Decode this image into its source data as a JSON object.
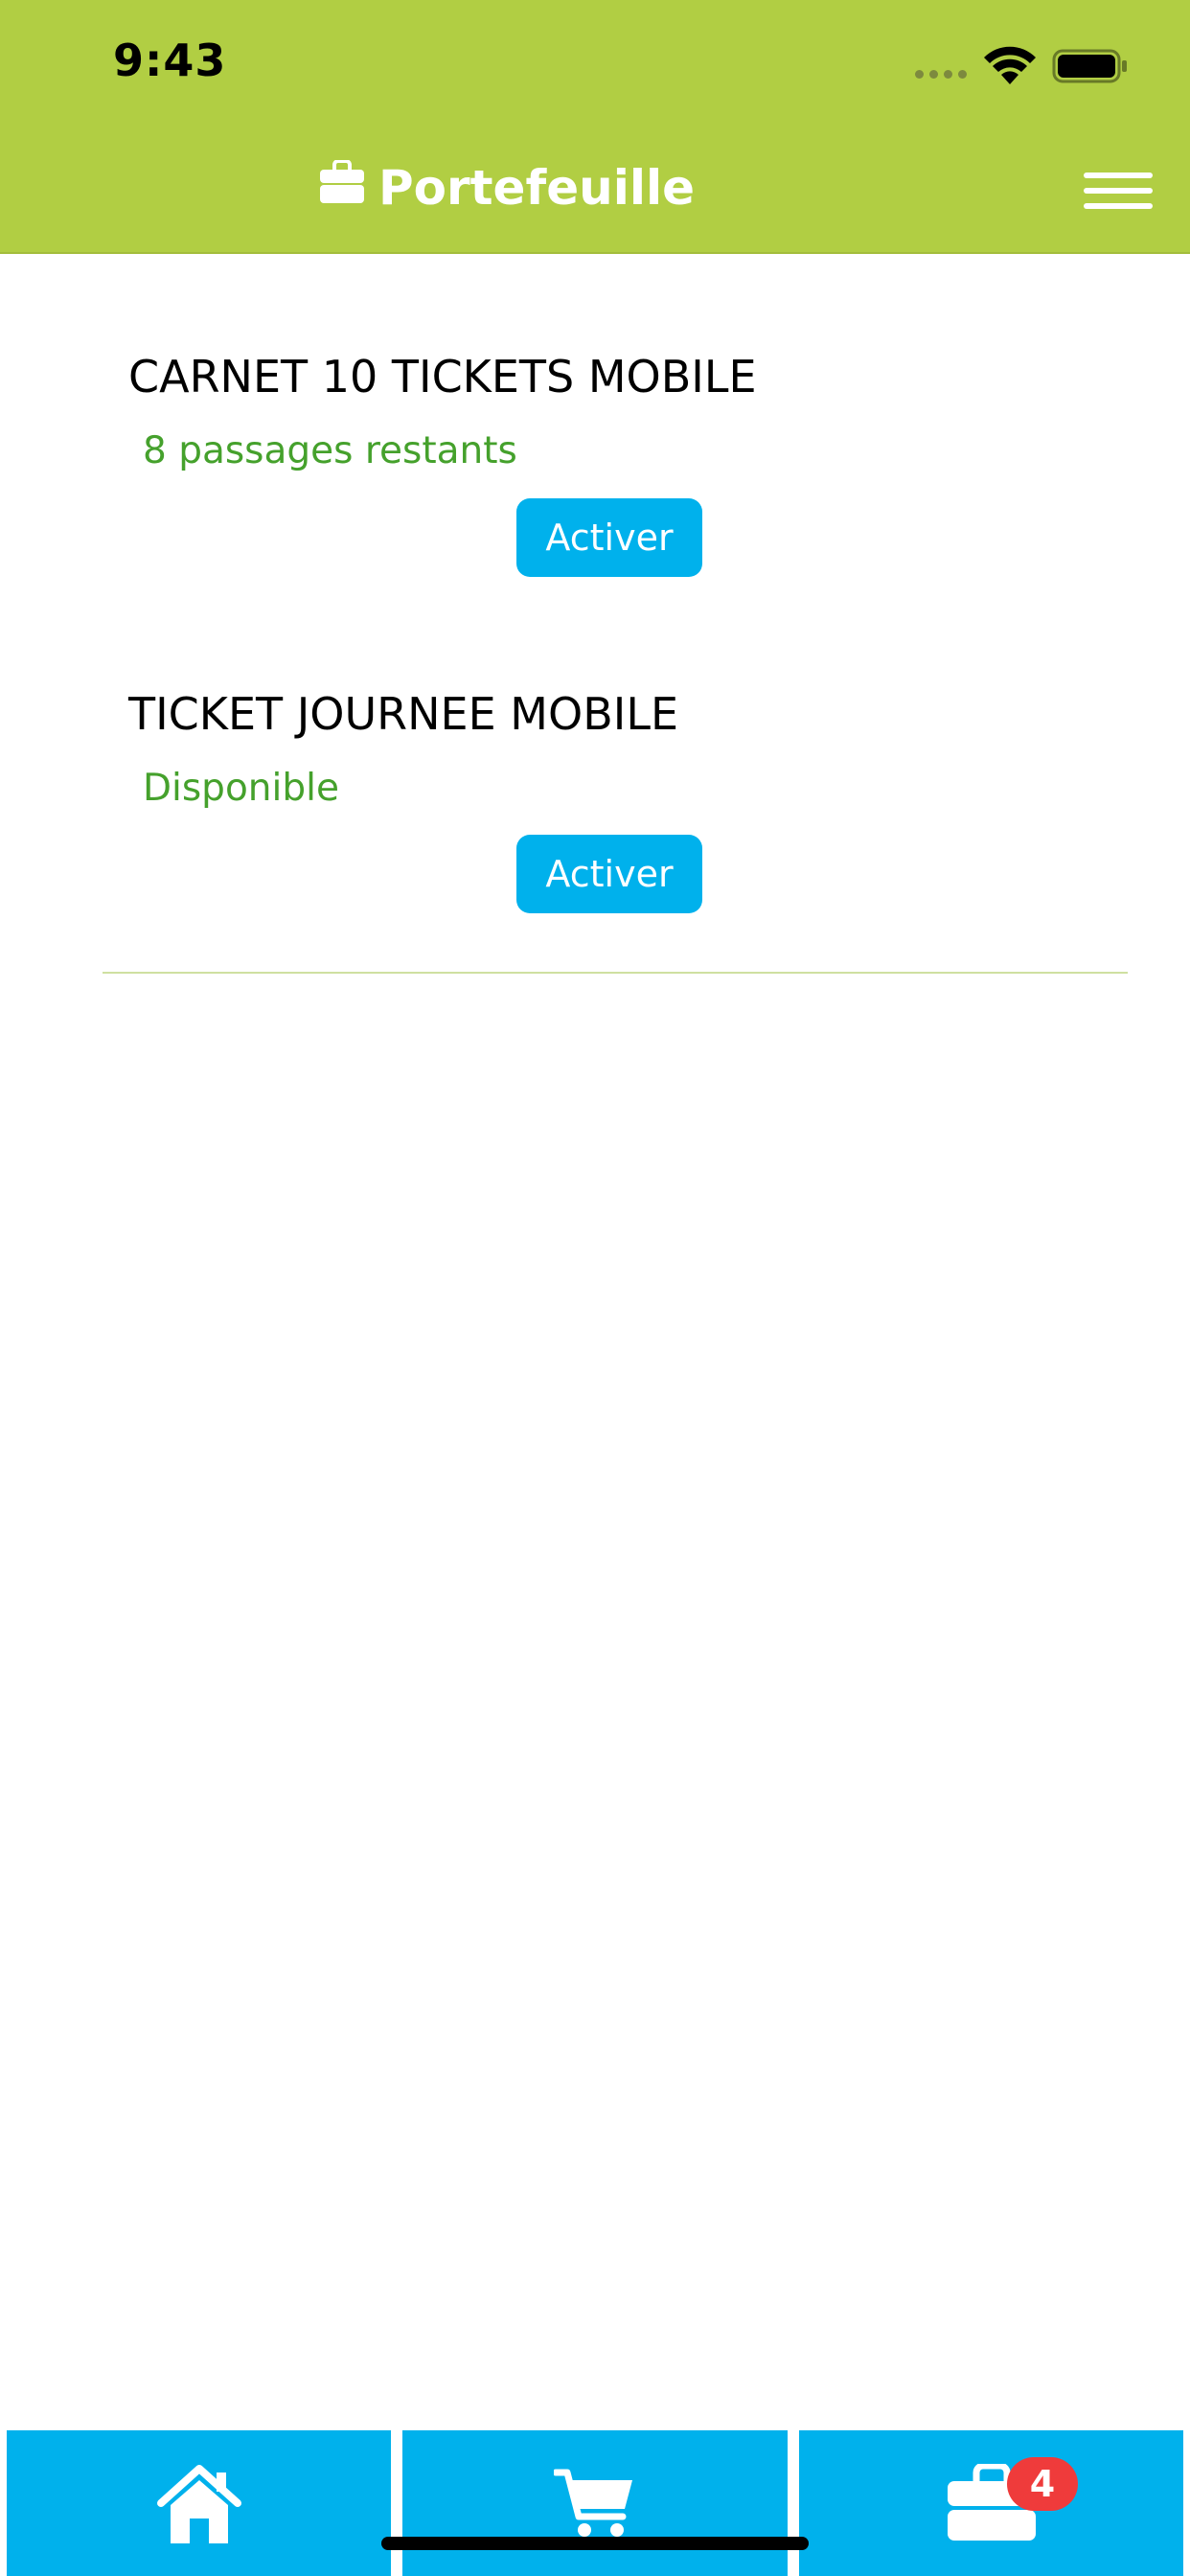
{
  "status_bar": {
    "time": "9:43"
  },
  "header": {
    "title": "Portefeuille",
    "title_icon": "briefcase-icon",
    "menu_icon": "hamburger-menu-icon"
  },
  "tickets": [
    {
      "name": "CARNET 10 TICKETS MOBILE",
      "status": "8 passages restants",
      "action_label": "Activer"
    },
    {
      "name": "TICKET JOURNEE MOBILE",
      "status": "Disponible",
      "action_label": "Activer"
    }
  ],
  "tabbar": {
    "tabs": [
      {
        "icon": "home-icon"
      },
      {
        "icon": "cart-icon"
      },
      {
        "icon": "briefcase-icon",
        "badge": "4"
      }
    ]
  },
  "colors": {
    "header_bg": "#b1ce43",
    "accent_blue": "#00b1ec",
    "status_green": "#45a12c",
    "badge_red": "#ef3b3b"
  }
}
